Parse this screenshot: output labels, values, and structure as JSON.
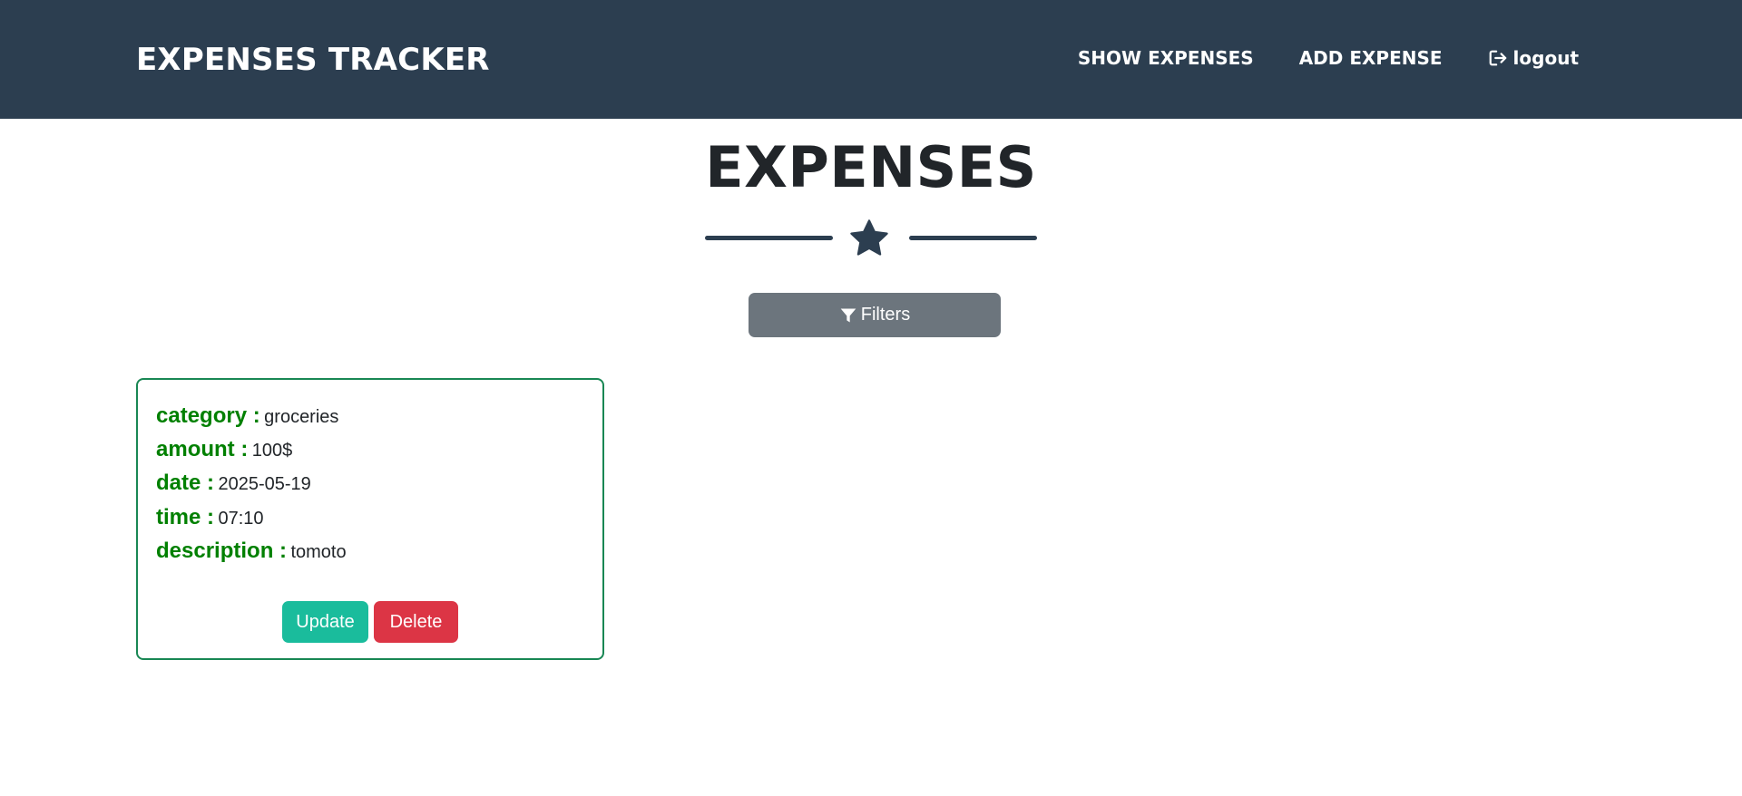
{
  "navbar": {
    "brand": "EXPENSES TRACKER",
    "links": {
      "show_expenses": "SHOW EXPENSES",
      "add_expense": "ADD EXPENSE",
      "logout": "logout"
    },
    "background": "#2c3e50"
  },
  "main": {
    "title": "EXPENSES",
    "divider_icon": "star-icon",
    "filters_button": {
      "label": "Filters",
      "icon": "filter-icon"
    }
  },
  "expenses": [
    {
      "category_label": "category :",
      "category": "groceries",
      "amount_label": "amount :",
      "amount": "100$",
      "date_label": "date :",
      "date": "2025-05-19",
      "time_label": "time :",
      "time": "07:10",
      "description_label": "description :",
      "description": "tomoto",
      "update_label": "Update",
      "delete_label": "Delete"
    }
  ],
  "colors": {
    "label_green": "#008000",
    "card_border": "#198754",
    "update": "#1abc9c",
    "delete": "#dc3545",
    "filters": "#6c757d"
  }
}
